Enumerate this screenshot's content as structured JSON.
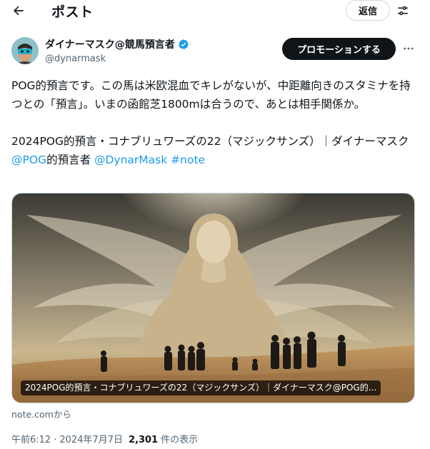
{
  "header": {
    "title": "ポスト",
    "reply_label": "返信",
    "back_icon": "arrow-left-icon",
    "settings_icon": "sliders-icon"
  },
  "author": {
    "display_name": "ダイナーマスク@競馬預言者",
    "handle": "@dynarmask",
    "verified_icon": "verified-badge-icon",
    "verified_color": "#1d9bf0",
    "promote_label": "プロモーションする",
    "more_icon": "more-horizontal-icon"
  },
  "post": {
    "paragraph1": "POG的預言です。この馬は米欧混血でキレがないが、中距離向きのスタミナを持つとの「預言」。いまの函館芝1800mは合うので、あとは相手関係か。",
    "paragraph2_text": "2024POG的預言・コナブリュワーズの22（マジックサンズ）｜ダイナーマスク",
    "mention_pog": "@POG",
    "paragraph2_mid": "的預言者 ",
    "mention_dynarmask": "@DynarMask",
    "hashtag": "#note",
    "link_color": "#1d9bf0"
  },
  "card": {
    "caption": "2024POG的預言・コナブリュワーズの22（マジックサンズ）｜ダイナーマスク@POG的...",
    "source": "note.comから"
  },
  "meta": {
    "time": "午前6:12",
    "separator": "·",
    "date": "2024年7月7日",
    "views_count": "2,301",
    "views_label": "件の表示"
  }
}
